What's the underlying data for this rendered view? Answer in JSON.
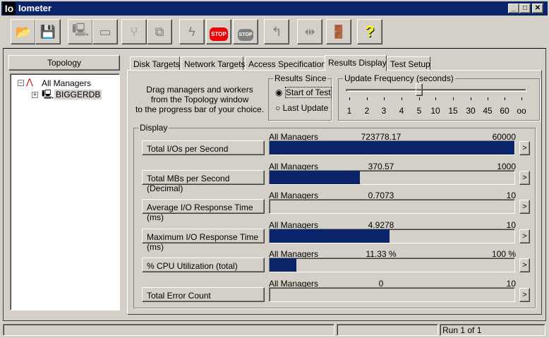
{
  "window": {
    "title": "Iometer",
    "logo": "Io"
  },
  "toolbar": [
    "open-icon",
    "save-icon",
    "start-manager-icon",
    "new-disk-worker-icon",
    "new-network-worker-icon",
    "duplicate-worker-icon",
    "start-icon",
    "stop-icon",
    "stop-all-icon",
    "reset-icon",
    "disconnect-icon",
    "exit-icon",
    "help-icon"
  ],
  "topology": {
    "title": "Topology",
    "root": "All Managers",
    "child": "BIGGERDB"
  },
  "tabs": [
    "Disk Targets",
    "Network Targets",
    "Access Specifications",
    "Results Display",
    "Test Setup"
  ],
  "active_tab": "Results Display",
  "instructions": "Drag managers and workers\nfrom the Topology window\nto the progress bar of your choice.",
  "results_since": {
    "label": "Results Since",
    "options": [
      "Start of Test",
      "Last Update"
    ],
    "selected": "Start of Test"
  },
  "update_frequency": {
    "label": "Update Frequency (seconds)",
    "ticks": [
      "1",
      "2",
      "3",
      "4",
      "5",
      "10",
      "15",
      "30",
      "45",
      "60",
      "oo"
    ],
    "selected": "5"
  },
  "display": {
    "label": "Display",
    "rows": [
      {
        "name": "Total I/Os per Second",
        "source": "All Managers",
        "value": "723778.17",
        "max": "60000",
        "fraction": 1.0
      },
      {
        "name": "Total MBs per Second (Decimal)",
        "source": "All Managers",
        "value": "370.57",
        "max": "1000",
        "fraction": 0.37
      },
      {
        "name": "Average I/O Response Time (ms)",
        "source": "All Managers",
        "value": "0.7073",
        "max": "10",
        "fraction": 0.0
      },
      {
        "name": "Maximum I/O Response Time (ms)",
        "source": "All Managers",
        "value": "4.9278",
        "max": "10",
        "fraction": 0.49
      },
      {
        "name": "% CPU Utilization (total)",
        "source": "All Managers",
        "value": "11.33 %",
        "max": "100 %",
        "fraction": 0.11
      },
      {
        "name": "Total Error Count",
        "source": "All Managers",
        "value": "0",
        "max": "10",
        "fraction": 0.0
      }
    ],
    "arrow": ">"
  },
  "status": {
    "run": "Run 1 of 1"
  },
  "colors": {
    "bar": "#0a246a"
  }
}
